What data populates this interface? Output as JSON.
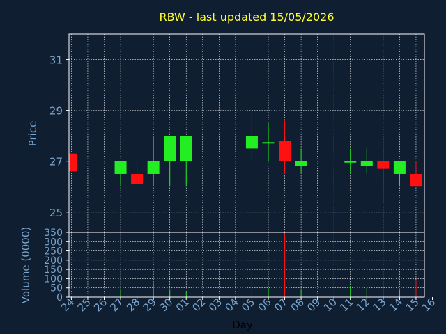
{
  "colors": {
    "background": "#0f1e30",
    "plot_border": "#ffffff",
    "grid": "#ffffff",
    "title": "#ffff33",
    "axis_text": "#7aa6cf",
    "xlabel": "#000000",
    "up": "#22ee22",
    "down": "#ff1111"
  },
  "chart_data": [
    {
      "type": "candlestick",
      "title": "RBW - last updated 15/05/2026",
      "ylabel": "Price",
      "ylim": [
        24.2,
        32.0
      ],
      "yticks": [
        25,
        27,
        29,
        31
      ],
      "x_categories": [
        "24",
        "25",
        "26",
        "27",
        "28",
        "29",
        "30",
        "01",
        "02",
        "03",
        "04",
        "05",
        "06",
        "07",
        "08",
        "09",
        "10",
        "11",
        "12",
        "13",
        "14",
        "15",
        "16"
      ],
      "grid": true,
      "candles": [
        {
          "day": "24",
          "open": 26.6,
          "high": 27.3,
          "low": 26.6,
          "close": 27.3,
          "direction": "down"
        },
        {
          "day": "27",
          "open": 26.5,
          "high": 27.0,
          "low": 26.0,
          "close": 27.0,
          "direction": "up"
        },
        {
          "day": "28",
          "open": 26.5,
          "high": 27.0,
          "low": 26.0,
          "close": 26.1,
          "direction": "down"
        },
        {
          "day": "29",
          "open": 26.5,
          "high": 28.0,
          "low": 26.0,
          "close": 27.0,
          "direction": "up"
        },
        {
          "day": "30",
          "open": 27.0,
          "high": 28.0,
          "low": 26.0,
          "close": 28.0,
          "direction": "up"
        },
        {
          "day": "01",
          "open": 27.0,
          "high": 28.0,
          "low": 26.0,
          "close": 28.0,
          "direction": "up"
        },
        {
          "day": "05",
          "open": 27.5,
          "high": 29.0,
          "low": 27.0,
          "close": 28.0,
          "direction": "up"
        },
        {
          "day": "06",
          "open": 27.7,
          "high": 28.5,
          "low": 27.0,
          "close": 27.75,
          "direction": "up"
        },
        {
          "day": "07",
          "open": 27.8,
          "high": 28.6,
          "low": 26.5,
          "close": 27.0,
          "direction": "down"
        },
        {
          "day": "08",
          "open": 26.8,
          "high": 27.5,
          "low": 26.5,
          "close": 27.0,
          "direction": "up"
        },
        {
          "day": "11",
          "open": 26.95,
          "high": 27.5,
          "low": 26.5,
          "close": 27.0,
          "direction": "up"
        },
        {
          "day": "12",
          "open": 26.8,
          "high": 27.5,
          "low": 26.5,
          "close": 27.0,
          "direction": "up"
        },
        {
          "day": "13",
          "open": 27.0,
          "high": 27.5,
          "low": 25.4,
          "close": 26.7,
          "direction": "down"
        },
        {
          "day": "14",
          "open": 26.5,
          "high": 27.0,
          "low": 26.0,
          "close": 27.0,
          "direction": "up"
        },
        {
          "day": "15",
          "open": 26.5,
          "high": 27.0,
          "low": 26.0,
          "close": 26.0,
          "direction": "down"
        }
      ]
    },
    {
      "type": "bar",
      "ylabel": "Volume (0000)",
      "xlabel": "Day",
      "ylim": [
        0,
        350
      ],
      "yticks": [
        0,
        50,
        100,
        150,
        200,
        250,
        300,
        350
      ],
      "x_categories": [
        "24",
        "25",
        "26",
        "27",
        "28",
        "29",
        "30",
        "01",
        "02",
        "03",
        "04",
        "05",
        "06",
        "07",
        "08",
        "09",
        "10",
        "11",
        "12",
        "13",
        "14",
        "15",
        "16"
      ],
      "grid": true,
      "bars": [
        {
          "day": "24",
          "value": 3,
          "direction": "down"
        },
        {
          "day": "27",
          "value": 40,
          "direction": "up"
        },
        {
          "day": "28",
          "value": 35,
          "direction": "down"
        },
        {
          "day": "29",
          "value": 75,
          "direction": "up"
        },
        {
          "day": "30",
          "value": 40,
          "direction": "up"
        },
        {
          "day": "01",
          "value": 30,
          "direction": "up"
        },
        {
          "day": "05",
          "value": 165,
          "direction": "up"
        },
        {
          "day": "06",
          "value": 50,
          "direction": "up"
        },
        {
          "day": "07",
          "value": 345,
          "direction": "down"
        },
        {
          "day": "08",
          "value": 40,
          "direction": "up"
        },
        {
          "day": "11",
          "value": 60,
          "direction": "up"
        },
        {
          "day": "12",
          "value": 50,
          "direction": "up"
        },
        {
          "day": "13",
          "value": 75,
          "direction": "down"
        },
        {
          "day": "14",
          "value": 40,
          "direction": "up"
        },
        {
          "day": "15",
          "value": 90,
          "direction": "down"
        }
      ]
    }
  ]
}
